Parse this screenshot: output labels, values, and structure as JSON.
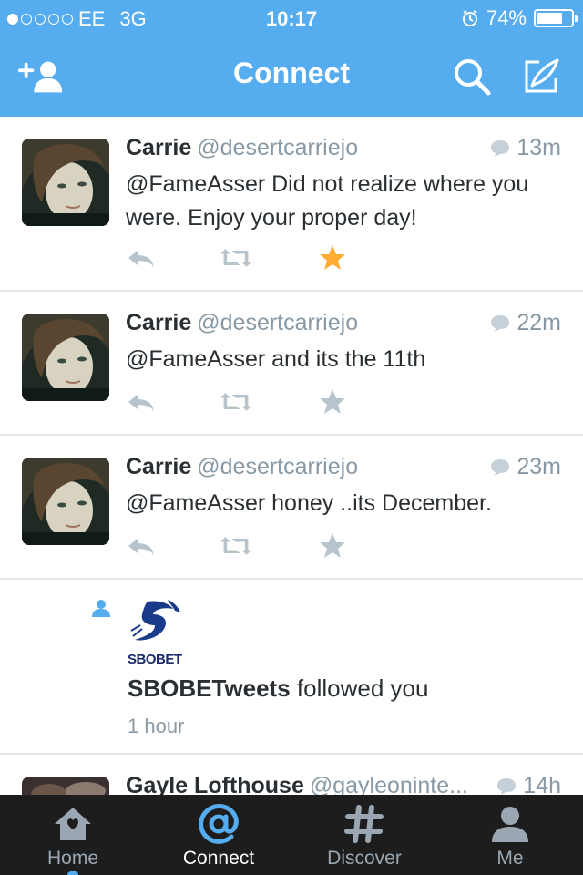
{
  "status_bar": {
    "carrier": "EE",
    "network": "3G",
    "time": "10:17",
    "battery": "74%",
    "battery_level": 0.74
  },
  "nav": {
    "title": "Connect",
    "icons": [
      "add-user-icon",
      "search-icon",
      "compose-icon"
    ]
  },
  "colors": {
    "brand": "#55acee",
    "favorited": "#ffac33",
    "muted": "#8899a6",
    "tabbar": "#1d1d1d"
  },
  "tweets": [
    {
      "name": "Carrie",
      "handle": "@desertcarriejo",
      "time": "13m",
      "text": "@FameAsser Did not realize where you were. Enjoy your proper day!",
      "favorited": true
    },
    {
      "name": "Carrie",
      "handle": "@desertcarriejo",
      "time": "22m",
      "text": "@FameAsser and its the 11th",
      "favorited": false
    },
    {
      "name": "Carrie",
      "handle": "@desertcarriejo",
      "time": "23m",
      "text": "@FameAsser honey ..its December.",
      "favorited": false
    }
  ],
  "follow_event": {
    "logo_text": "SBOBET",
    "user": "SBOBETweets",
    "action": "followed you",
    "time": "1 hour"
  },
  "partial_tweet": {
    "name": "Gayle Lofthouse",
    "handle": "@gayleoninte...",
    "time": "14h"
  },
  "tabs": [
    {
      "label": "Home",
      "icon": "home-icon"
    },
    {
      "label": "Connect",
      "icon": "at-icon",
      "active": true
    },
    {
      "label": "Discover",
      "icon": "hashtag-icon"
    },
    {
      "label": "Me",
      "icon": "person-icon"
    }
  ]
}
